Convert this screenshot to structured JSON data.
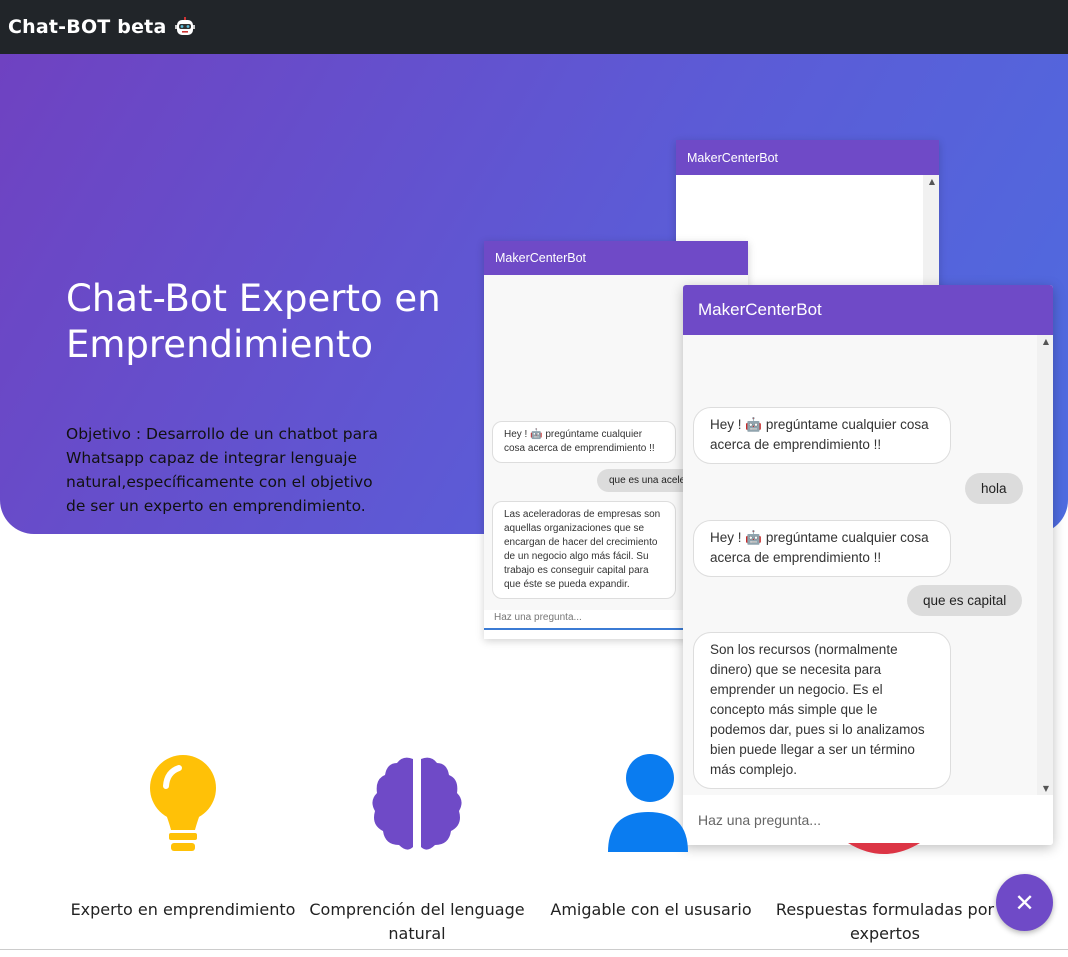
{
  "navbar": {
    "brand": "Chat-BOT beta",
    "brand_icon": "robot-icon"
  },
  "hero": {
    "title": "Chat-Bot Experto en Emprendimiento",
    "description": "Objetivo : Desarrollo de un chatbot para Whatsapp capaz de integrar lenguaje natural,específicamente con el objetivo de ser un experto en emprendimiento."
  },
  "chat_back": {
    "title": "MakerCenterBot"
  },
  "chat_mid": {
    "title": "MakerCenterBot",
    "messages": [
      {
        "from": "bot",
        "text": "Hey ! 🤖 pregúntame cualquier cosa acerca de emprendimiento !!"
      },
      {
        "from": "user",
        "text": "que es una acele"
      },
      {
        "from": "bot",
        "text": "Las aceleradoras de empresas son aquellas organizaciones que se encargan de hacer del crecimiento de un negocio algo más fácil. Su trabajo es conseguir capital para que éste se pueda expandir."
      }
    ],
    "input_placeholder": "Haz una pregunta..."
  },
  "chat_front": {
    "title": "MakerCenterBot",
    "messages": [
      {
        "from": "bot",
        "text": "Hey ! 🤖 pregúntame cualquier cosa acerca de emprendimiento !!"
      },
      {
        "from": "user",
        "text": "hola"
      },
      {
        "from": "bot",
        "text": "Hey ! 🤖 pregúntame cualquier cosa acerca de emprendimiento !!"
      },
      {
        "from": "user",
        "text": "que es capital"
      },
      {
        "from": "bot",
        "text": "Son los recursos (normalmente dinero) que se necesita para emprender un negocio. Es el concepto más simple que le podemos dar, pues si lo analizamos bien puede llegar a ser un término más complejo."
      }
    ],
    "input_placeholder": "Haz una pregunta..."
  },
  "features": [
    {
      "icon": "lightbulb-icon",
      "label": "Experto en emprendimiento",
      "color": "#ffc107"
    },
    {
      "icon": "brain-icon",
      "label": "Comprención del lenguage natural",
      "color": "#6f42c1"
    },
    {
      "icon": "user-icon",
      "label": "Amigable con el ususario",
      "color": "#0d6efd"
    },
    {
      "icon": "circle-icon",
      "label": "Respuestas formuladas por expertos",
      "color": "#dc3545"
    }
  ],
  "fab": {
    "icon": "close-icon",
    "label": "✕"
  },
  "colors": {
    "navbar": "#212529",
    "accent": "#6f4ac7",
    "hero_start": "#6f42c1",
    "hero_end": "#4e6ce0"
  }
}
